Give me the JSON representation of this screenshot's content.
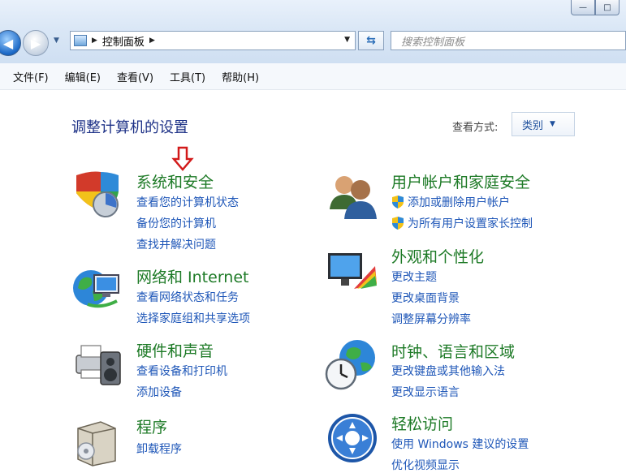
{
  "toolbar": {
    "breadcrumb_root": "控制面板",
    "search_placeholder": "搜索控制面板"
  },
  "menu": [
    "文件(F)",
    "编辑(E)",
    "查看(V)",
    "工具(T)",
    "帮助(H)"
  ],
  "main": {
    "title": "调整计算机的设置",
    "view_by_label": "查看方式:",
    "view_by_value": "类别"
  },
  "categories": [
    {
      "title": "系统和安全",
      "icon": "shield-icon",
      "links": [
        "查看您的计算机状态",
        "备份您的计算机",
        "查找并解决问题"
      ]
    },
    {
      "title": "网络和 Internet",
      "icon": "network-globe-icon",
      "links": [
        "查看网络状态和任务",
        "选择家庭组和共享选项"
      ]
    },
    {
      "title": "硬件和声音",
      "icon": "printer-speaker-icon",
      "links": [
        "查看设备和打印机",
        "添加设备"
      ]
    },
    {
      "title": "程序",
      "icon": "programs-box-icon",
      "links": [
        "卸载程序"
      ]
    },
    {
      "title": "用户帐户和家庭安全",
      "icon": "users-icon",
      "links": [
        "添加或删除用户帐户",
        "为所有用户设置家长控制"
      ]
    },
    {
      "title": "外观和个性化",
      "icon": "monitor-palette-icon",
      "links": [
        "更改主题",
        "更改桌面背景",
        "调整屏幕分辨率"
      ]
    },
    {
      "title": "时钟、语言和区域",
      "icon": "clock-globe-icon",
      "links": [
        "更改键盘或其他输入法",
        "更改显示语言"
      ]
    },
    {
      "title": "轻松访问",
      "icon": "ease-of-access-icon",
      "links": [
        "使用 Windows 建议的设置",
        "优化视频显示"
      ]
    }
  ],
  "colors": {
    "category_title": "#1d7a26",
    "link": "#1f57b8",
    "page_title": "#1e3287",
    "annotation_arrow": "#d21a1a"
  }
}
